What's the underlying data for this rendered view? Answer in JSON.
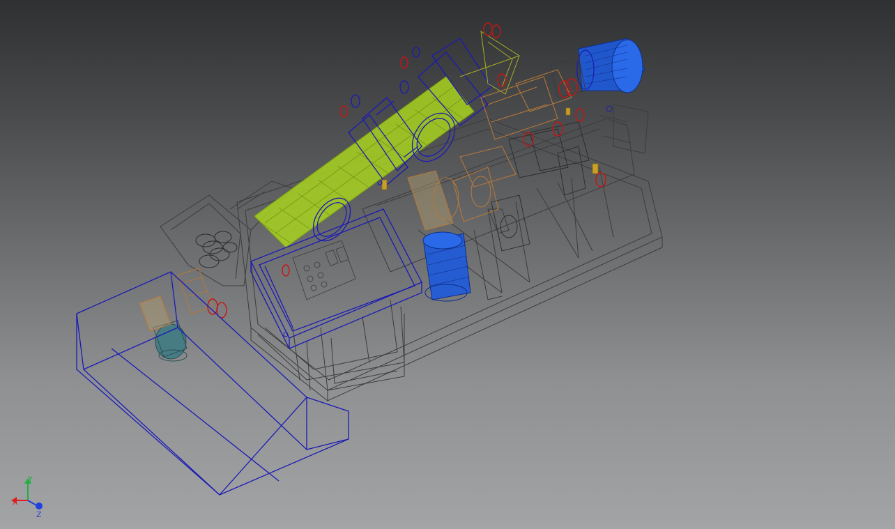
{
  "viewcube_axes": {
    "x_label": "X",
    "y_label": "Y",
    "z_label": "Z"
  },
  "colors": {
    "background_top": "#2f3032",
    "background_bottom": "#a3a4a6",
    "frame_wire": "#3c3c3c",
    "selected_wire": "#1a1ab4",
    "screw_conveyor": "#a8d21e",
    "motor_blue": "#1e5adc",
    "fastener_red": "#c81414",
    "bracket_orange": "#b4783c",
    "axis_x": "#dc2020",
    "axis_y": "#20b040",
    "axis_z": "#2040dc"
  }
}
